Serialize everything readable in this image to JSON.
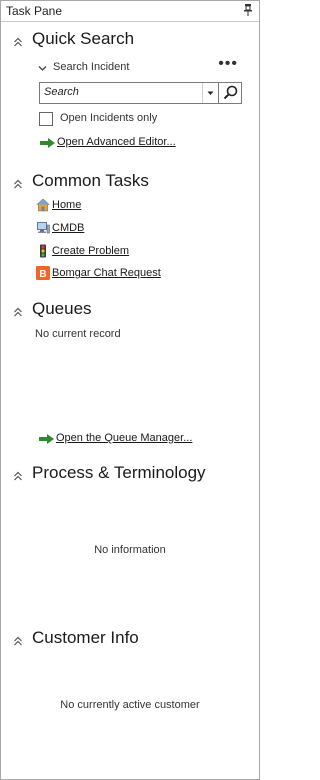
{
  "window": {
    "title": "Task Pane",
    "pin_icon": "pin-icon"
  },
  "quick_search": {
    "header": "Quick Search",
    "sub_header": "Search Incident",
    "more_label": "•••",
    "search_value": "Search",
    "open_incidents_label": "Open Incidents only",
    "advanced_link": "Open Advanced Editor..."
  },
  "common_tasks": {
    "header": "Common Tasks",
    "items": [
      {
        "label": "Home",
        "icon": "home-icon"
      },
      {
        "label": "CMDB",
        "icon": "computer-icon"
      },
      {
        "label": "Create Problem",
        "icon": "traffic-light-icon"
      },
      {
        "label": "Bomgar Chat Request",
        "icon": "bomgar-icon"
      }
    ]
  },
  "queues": {
    "header": "Queues",
    "status": "No current record",
    "manager_link": "Open the Queue Manager..."
  },
  "process": {
    "header": "Process & Terminology",
    "status": "No information"
  },
  "customer": {
    "header": "Customer Info",
    "status": "No currently active customer"
  },
  "colors": {
    "arrow_green": "#2e8b2e",
    "bomgar_orange": "#f26522",
    "border": "#a8a8a8"
  }
}
